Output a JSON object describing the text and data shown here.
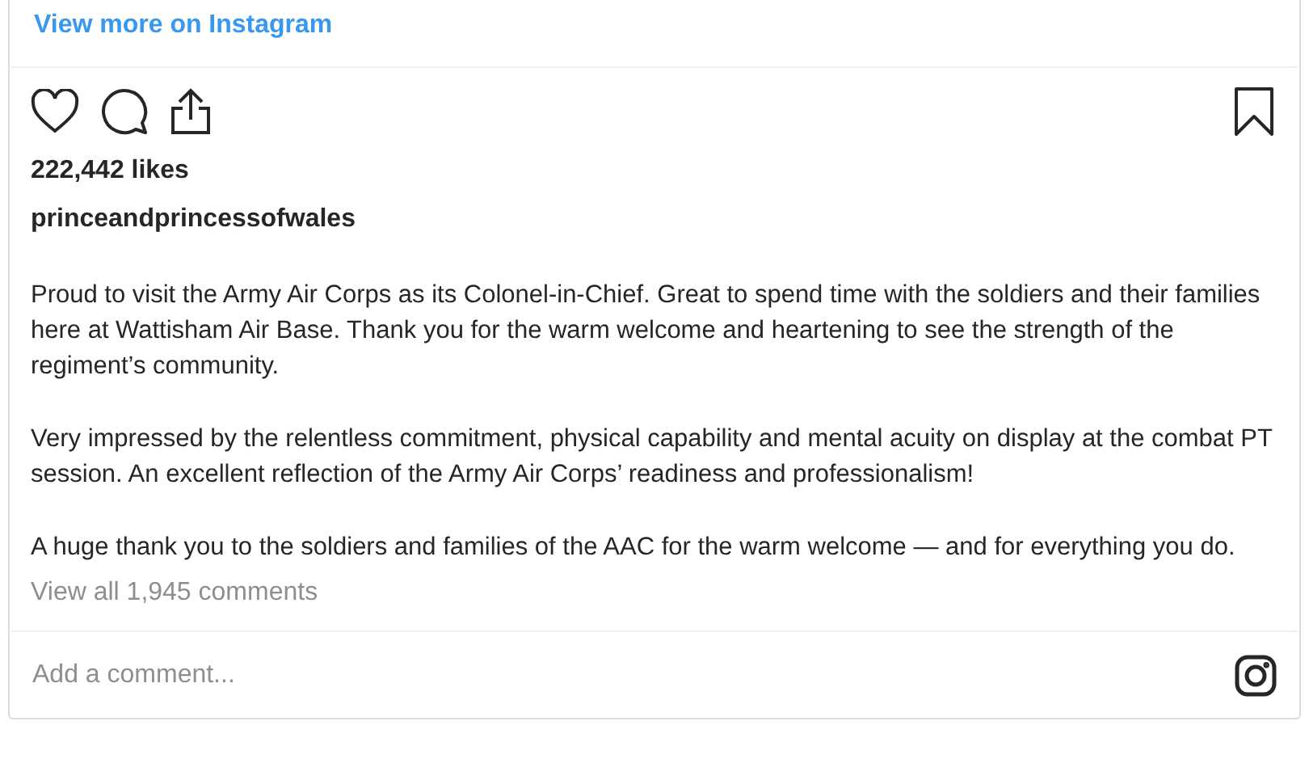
{
  "header": {
    "link": "View more on Instagram"
  },
  "actions": {
    "liked": false,
    "saved": false
  },
  "likes": "222,442 likes",
  "username": "princeandprincessofwales",
  "caption": [
    "Proud to visit the Army Air Corps as its Colonel-in-Chief. Great to spend time with the soldiers and their families here at Wattisham Air Base. Thank you for the warm welcome and heartening to see the strength of the regiment’s community.",
    "Very impressed by the relentless commitment, physical capability and mental acuity on display at the combat PT session. An excellent reflection of the Army Air Corps’ readiness and professionalism!",
    "A huge thank you to the soldiers and families of the AAC for the warm welcome — and for everything you do."
  ],
  "comments_link": "View all 1,945 comments",
  "comment_field": {
    "placeholder": "Add a comment..."
  }
}
